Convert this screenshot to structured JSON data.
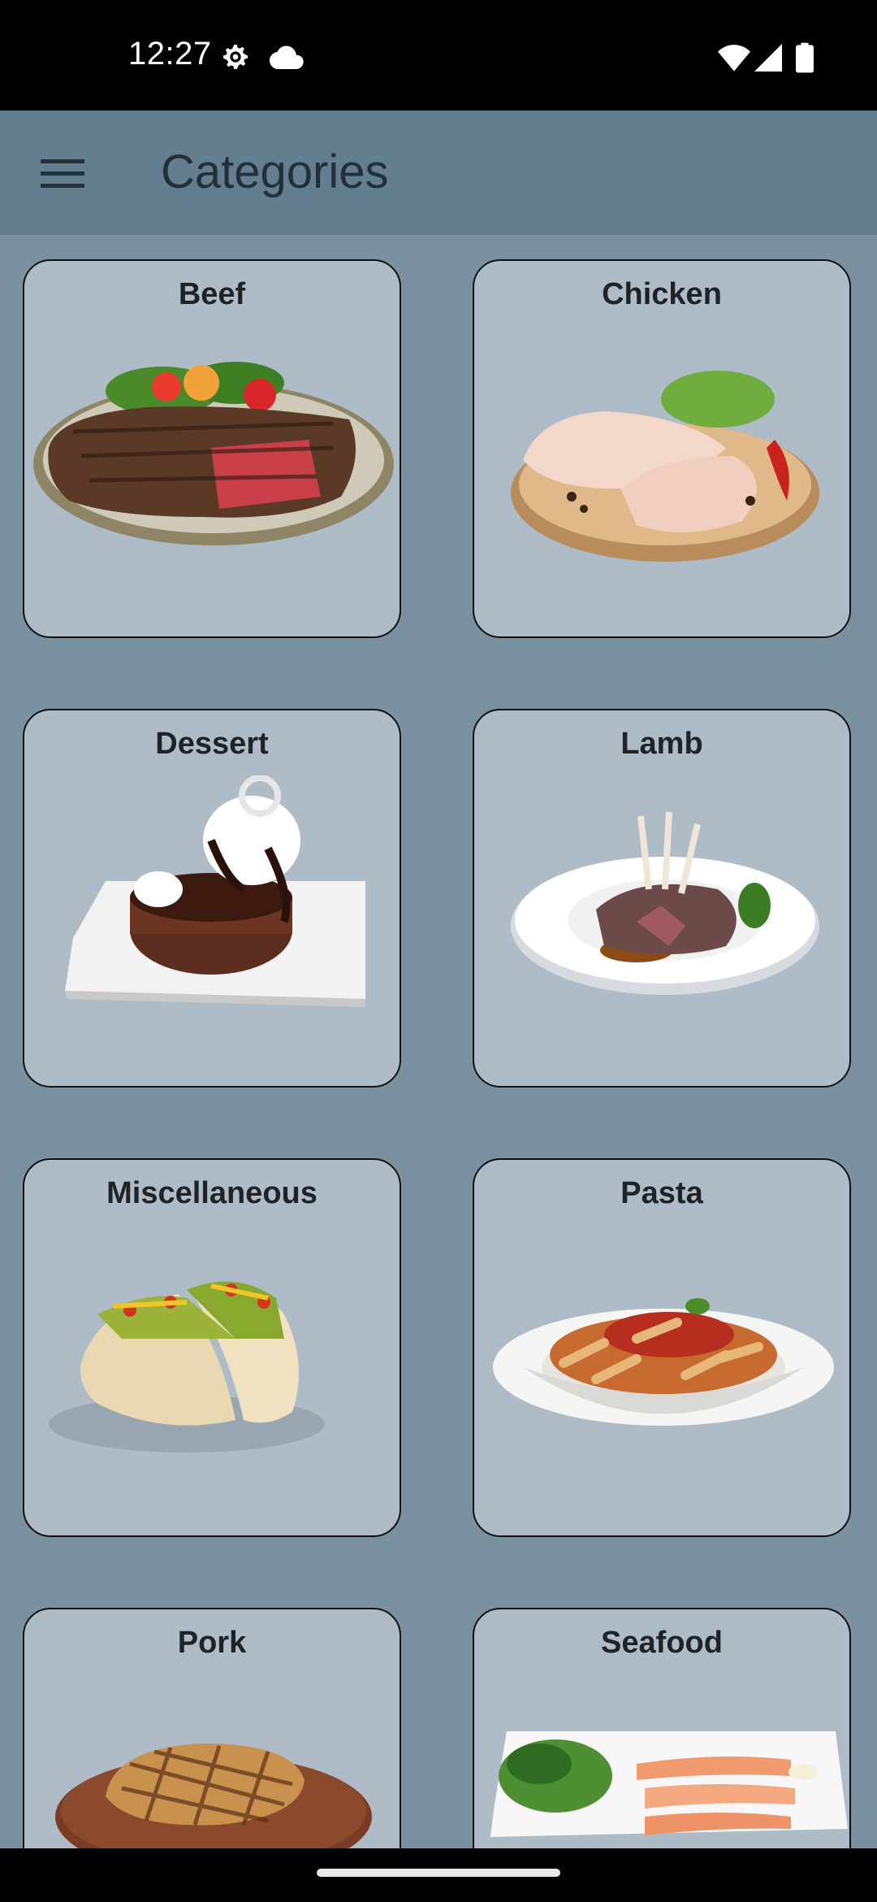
{
  "status_bar": {
    "time": "12:27",
    "icons": [
      "settings-gear-icon",
      "cloud-icon",
      "wifi-icon",
      "cell-signal-icon",
      "battery-icon"
    ]
  },
  "app_bar": {
    "title": "Categories",
    "menu_icon": "hamburger-menu-icon"
  },
  "categories": [
    {
      "label": "Beef"
    },
    {
      "label": "Chicken"
    },
    {
      "label": "Dessert"
    },
    {
      "label": "Lamb"
    },
    {
      "label": "Miscellaneous"
    },
    {
      "label": "Pasta"
    },
    {
      "label": "Pork"
    },
    {
      "label": "Seafood"
    }
  ],
  "colors": {
    "background": "#7a919f",
    "app_bar": "#637f8f",
    "card": "#adbcc6",
    "card_border": "#111111"
  }
}
